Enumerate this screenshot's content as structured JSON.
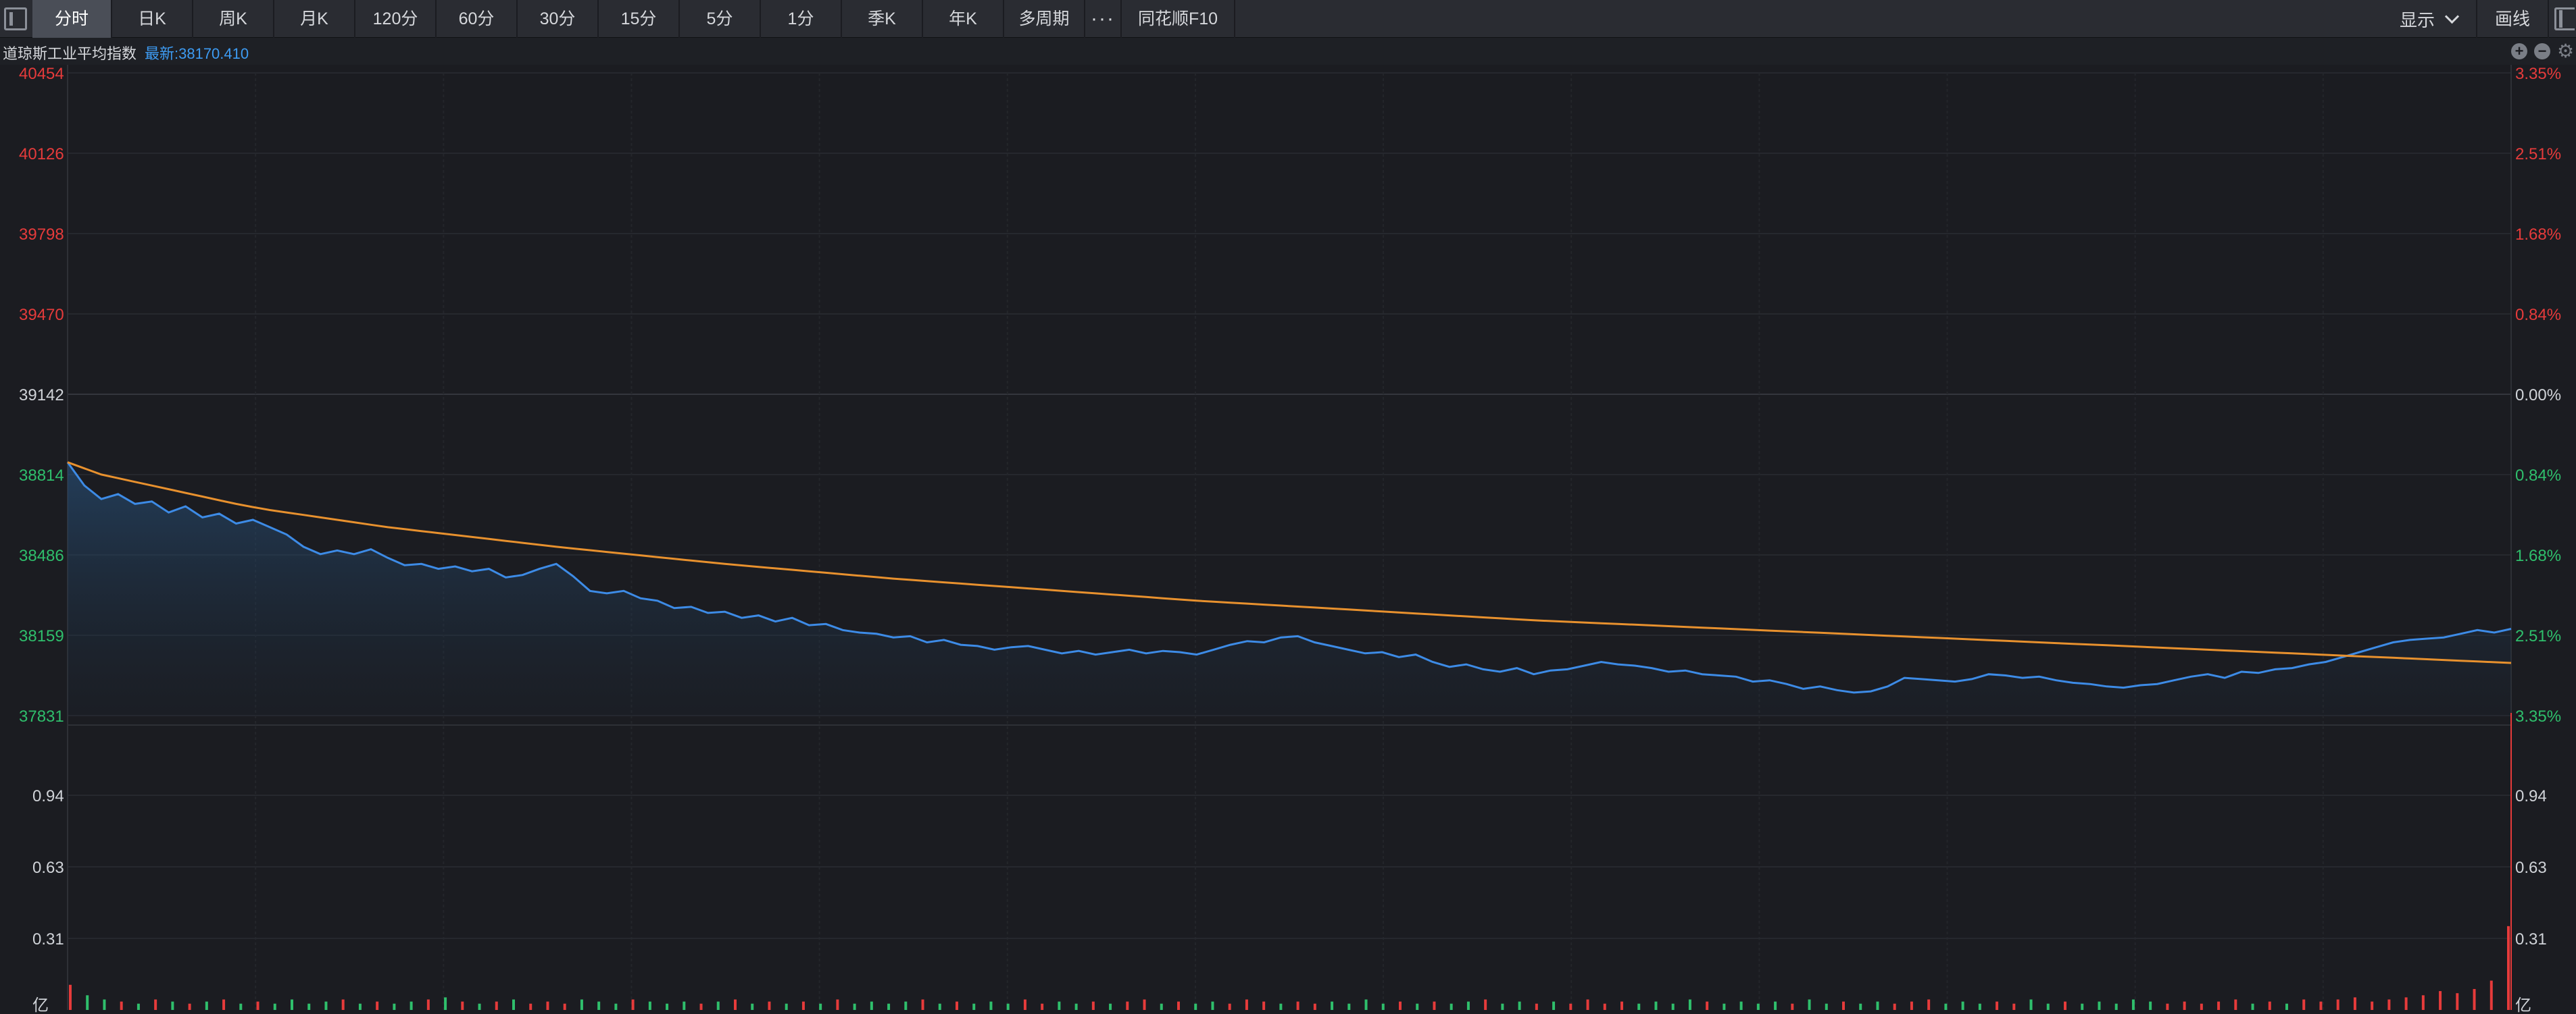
{
  "toolbar": {
    "tabs": [
      {
        "label": "分时",
        "active": true
      },
      {
        "label": "日K"
      },
      {
        "label": "周K"
      },
      {
        "label": "月K"
      },
      {
        "label": "120分"
      },
      {
        "label": "60分"
      },
      {
        "label": "30分"
      },
      {
        "label": "15分"
      },
      {
        "label": "5分"
      },
      {
        "label": "1分"
      },
      {
        "label": "季K"
      },
      {
        "label": "年K"
      },
      {
        "label": "多周期"
      },
      {
        "label": "···"
      },
      {
        "label": "同花顺F10"
      }
    ],
    "display_label": "显示",
    "draw_label": "画线"
  },
  "info": {
    "index_name": "道琼斯工业平均指数",
    "latest": "最新:38170.410"
  },
  "colors": {
    "up": "#e63b3b",
    "down": "#2fbf6c",
    "neutral": "#d0d3d8",
    "price_line": "#3d8be6",
    "avg_line": "#e8912e",
    "background": "#1b1c21"
  },
  "chart_data": {
    "type": "line",
    "ylim": [
      37831,
      40454
    ],
    "base": 39142,
    "price_ticks_left": [
      "40454",
      "40126",
      "39798",
      "39470",
      "39142",
      "38814",
      "38486",
      "38159",
      "37831"
    ],
    "pct_ticks_right": [
      "3.35%",
      "2.51%",
      "1.68%",
      "0.84%",
      "0.00%",
      "0.84%",
      "1.68%",
      "2.51%",
      "3.35%"
    ],
    "volume_ticks": [
      "0.94",
      "0.63",
      "0.31",
      "亿"
    ],
    "volume_max": 1.25,
    "series": [
      {
        "values": [
          38865,
          38770,
          38715,
          38735,
          38695,
          38705,
          38660,
          38685,
          38640,
          38655,
          38615,
          38630,
          38600,
          38570,
          38520,
          38490,
          38505,
          38490,
          38510,
          38475,
          38445,
          38450,
          38430,
          38440,
          38420,
          38430,
          38395,
          38405,
          38430,
          38450,
          38400,
          38340,
          38330,
          38340,
          38310,
          38300,
          38270,
          38275,
          38250,
          38255,
          38230,
          38240,
          38215,
          38230,
          38200,
          38205,
          38180,
          38170,
          38165,
          38150,
          38155,
          38130,
          38140,
          38120,
          38115,
          38100,
          38110,
          38115,
          38100,
          38085,
          38095,
          38080,
          38090,
          38100,
          38085,
          38095,
          38090,
          38080,
          38100,
          38120,
          38135,
          38130,
          38150,
          38155,
          38130,
          38115,
          38100,
          38085,
          38090,
          38070,
          38080,
          38050,
          38030,
          38040,
          38020,
          38010,
          38025,
          38000,
          38015,
          38020,
          38035,
          38050,
          38040,
          38035,
          38025,
          38010,
          38015,
          38000,
          37995,
          37990,
          37970,
          37975,
          37960,
          37940,
          37950,
          37935,
          37925,
          37930,
          37950,
          37985,
          37980,
          37975,
          37970,
          37980,
          38000,
          37995,
          37985,
          37990,
          37975,
          37965,
          37960,
          37950,
          37945,
          37955,
          37960,
          37975,
          37990,
          38000,
          37985,
          38010,
          38005,
          38020,
          38025,
          38040,
          38050,
          38070,
          38090,
          38110,
          38130,
          38140,
          38145,
          38150,
          38165,
          38180,
          38170,
          38185
        ]
      },
      {
        "values": [
          38865,
          38840,
          38815,
          38800,
          38785,
          38770,
          38755,
          38740,
          38725,
          38710,
          38695,
          38682,
          38670,
          38660,
          38650,
          38640,
          38630,
          38620,
          38610,
          38600,
          38592,
          38584,
          38576,
          38568,
          38560,
          38552,
          38544,
          38536,
          38528,
          38520,
          38513,
          38506,
          38499,
          38492,
          38485,
          38478,
          38471,
          38464,
          38457,
          38450,
          38444,
          38438,
          38432,
          38426,
          38420,
          38414,
          38408,
          38402,
          38396,
          38390,
          38385,
          38380,
          38375,
          38370,
          38365,
          38360,
          38355,
          38350,
          38345,
          38340,
          38335,
          38330,
          38325,
          38320,
          38315,
          38310,
          38305,
          38300,
          38296,
          38292,
          38288,
          38284,
          38280,
          38276,
          38272,
          38268,
          38264,
          38260,
          38256,
          38252,
          38248,
          38244,
          38240,
          38236,
          38232,
          38228,
          38224,
          38220,
          38217,
          38214,
          38211,
          38208,
          38205,
          38202,
          38199,
          38196,
          38193,
          38190,
          38187,
          38184,
          38181,
          38178,
          38175,
          38172,
          38169,
          38166,
          38163,
          38160,
          38157,
          38154,
          38151,
          38148,
          38145,
          38142,
          38139,
          38136,
          38133,
          38130,
          38127,
          38124,
          38121,
          38118,
          38115,
          38112,
          38109,
          38106,
          38103,
          38100,
          38097,
          38094,
          38091,
          38088,
          38085,
          38082,
          38079,
          38076,
          38073,
          38070,
          38067,
          38064,
          38061,
          38058,
          38055,
          38052,
          38049,
          38046
        ]
      }
    ],
    "volume": [
      0.12,
      0.07,
      0.05,
      0.04,
      0.03,
      0.05,
      0.04,
      0.03,
      0.04,
      0.05,
      0.03,
      0.04,
      0.03,
      0.05,
      0.03,
      0.04,
      0.05,
      0.03,
      0.04,
      0.03,
      0.04,
      0.05,
      0.06,
      0.04,
      0.03,
      0.04,
      0.05,
      0.03,
      0.04,
      0.03,
      0.05,
      0.04,
      0.03,
      0.05,
      0.04,
      0.03,
      0.04,
      0.03,
      0.04,
      0.05,
      0.03,
      0.04,
      0.03,
      0.04,
      0.03,
      0.05,
      0.03,
      0.04,
      0.03,
      0.04,
      0.05,
      0.03,
      0.04,
      0.03,
      0.04,
      0.03,
      0.05,
      0.03,
      0.04,
      0.03,
      0.04,
      0.03,
      0.04,
      0.05,
      0.03,
      0.04,
      0.03,
      0.04,
      0.03,
      0.05,
      0.04,
      0.03,
      0.04,
      0.03,
      0.04,
      0.03,
      0.05,
      0.03,
      0.04,
      0.03,
      0.04,
      0.03,
      0.04,
      0.05,
      0.03,
      0.04,
      0.03,
      0.04,
      0.03,
      0.05,
      0.03,
      0.04,
      0.03,
      0.04,
      0.03,
      0.05,
      0.04,
      0.03,
      0.04,
      0.03,
      0.04,
      0.03,
      0.05,
      0.03,
      0.04,
      0.03,
      0.04,
      0.03,
      0.04,
      0.05,
      0.03,
      0.04,
      0.03,
      0.04,
      0.03,
      0.05,
      0.03,
      0.04,
      0.03,
      0.04,
      0.03,
      0.05,
      0.04,
      0.03,
      0.04,
      0.03,
      0.04,
      0.05,
      0.03,
      0.04,
      0.03,
      0.05,
      0.04,
      0.05,
      0.06,
      0.04,
      0.05,
      0.06,
      0.07,
      0.09,
      0.08,
      0.1,
      0.14,
      0.4
    ]
  }
}
